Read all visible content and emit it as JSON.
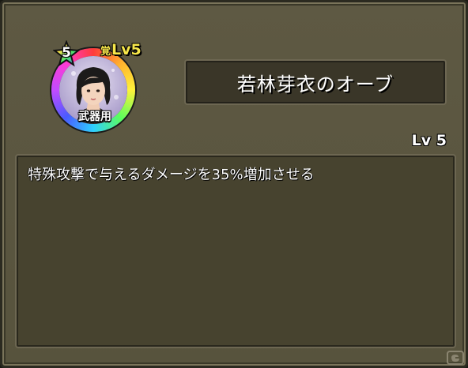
{
  "orb": {
    "rarity": "5",
    "level_mark": "覚",
    "level_label": "Lv5",
    "type_label": "武器用",
    "ring_colors": [
      "#ff3b3b",
      "#ffb02e",
      "#fff23a",
      "#5cff5c",
      "#2ecfff",
      "#4a5bff",
      "#c24bff",
      "#ff3bd3"
    ]
  },
  "item": {
    "name": "若林芽衣のオーブ",
    "level": "Lv 5",
    "description": "特殊攻撃で与えるダメージを35%増加させる"
  },
  "colors": {
    "panel_bg": "#5e5943",
    "box_bg": "#47432f",
    "level_yellow": "#f6e64a"
  }
}
